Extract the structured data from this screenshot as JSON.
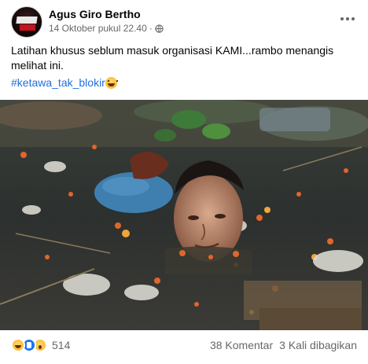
{
  "post": {
    "author": "Agus Giro Bertho",
    "timestamp": "14 Oktober pukul 22.40",
    "separator": "·",
    "privacy_icon": "globe-icon",
    "more_icon": "more-options-icon",
    "avatar_text": "DALI DAY",
    "text": "Latihan khusus seblum masuk organisasi KAMI...rambo menangis melihat ini.",
    "hashtag": "#ketawa_tak_blokir",
    "hashtag_emoji": "laughing-emoji-icon",
    "image_description_icon": "photo"
  },
  "footer": {
    "reaction_icons": [
      "haha-reaction-icon",
      "like-reaction-icon",
      "wow-reaction-icon"
    ],
    "reaction_count": "514",
    "comments": "38 Komentar",
    "shares": "3 Kali dibagikan"
  },
  "colors": {
    "link": "#216fdb",
    "muted": "#65676b",
    "like_blue": "#1877f2"
  }
}
